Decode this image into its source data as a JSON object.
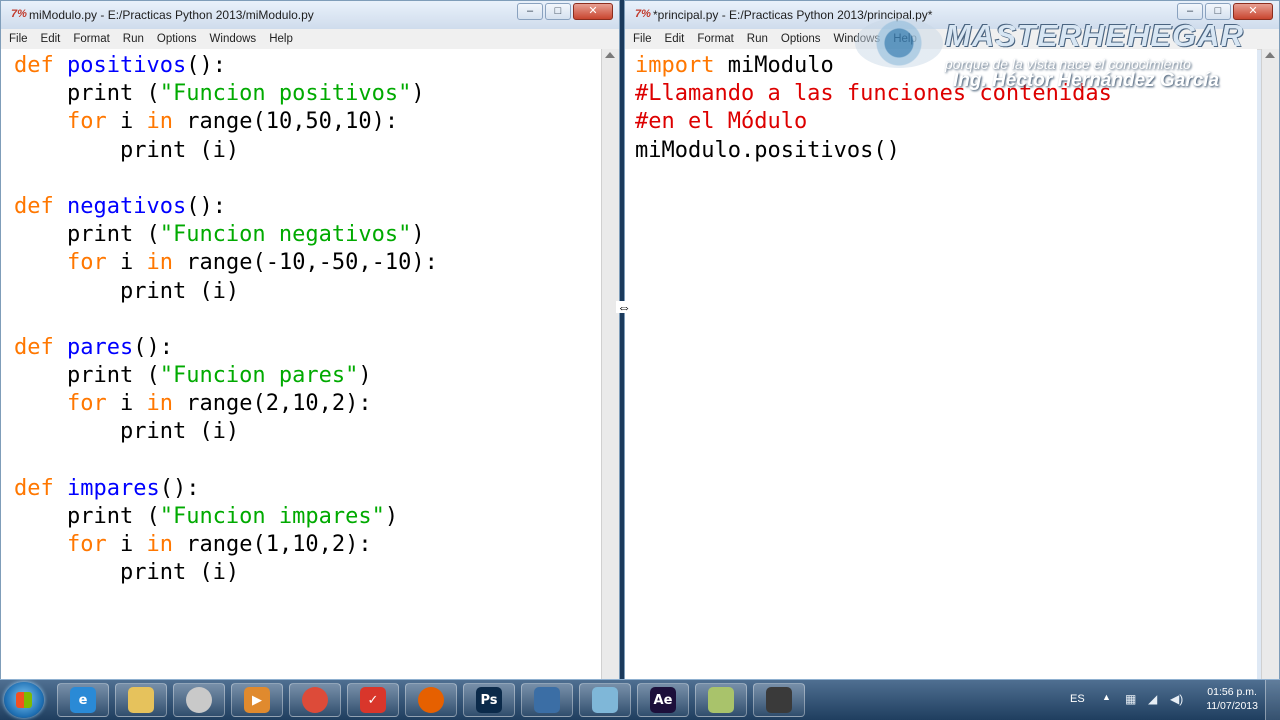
{
  "left_window": {
    "title": "miModulo.py - E:/Practicas Python 2013/miModulo.py",
    "icon_text": "7%",
    "menu": [
      "File",
      "Edit",
      "Format",
      "Run",
      "Options",
      "Windows",
      "Help"
    ],
    "code": [
      [
        {
          "t": "def",
          "c": "kw"
        },
        {
          "t": " "
        },
        {
          "t": "positivos",
          "c": "fn"
        },
        {
          "t": "():"
        }
      ],
      [
        {
          "t": "    print "
        },
        {
          "t": "(\"Funcion positivos\")",
          "c": "st_wrap"
        }
      ],
      [
        {
          "t": "    "
        },
        {
          "t": "for",
          "c": "kw"
        },
        {
          "t": " i "
        },
        {
          "t": "in",
          "c": "kw"
        },
        {
          "t": " range(10,50,10):"
        }
      ],
      [
        {
          "t": "        print (i)"
        }
      ],
      [
        {
          "t": ""
        }
      ],
      [
        {
          "t": "def",
          "c": "kw"
        },
        {
          "t": " "
        },
        {
          "t": "negativos",
          "c": "fn"
        },
        {
          "t": "():"
        }
      ],
      [
        {
          "t": "    print "
        },
        {
          "t": "(\"Funcion negativos\")",
          "c": "st_wrap"
        }
      ],
      [
        {
          "t": "    "
        },
        {
          "t": "for",
          "c": "kw"
        },
        {
          "t": " i "
        },
        {
          "t": "in",
          "c": "kw"
        },
        {
          "t": " range(-10,-50,-10):"
        }
      ],
      [
        {
          "t": "        print (i)"
        }
      ],
      [
        {
          "t": ""
        }
      ],
      [
        {
          "t": "def",
          "c": "kw"
        },
        {
          "t": " "
        },
        {
          "t": "pares",
          "c": "fn"
        },
        {
          "t": "():"
        }
      ],
      [
        {
          "t": "    print "
        },
        {
          "t": "(\"Funcion pares\")",
          "c": "st_wrap"
        }
      ],
      [
        {
          "t": "    "
        },
        {
          "t": "for",
          "c": "kw"
        },
        {
          "t": " i "
        },
        {
          "t": "in",
          "c": "kw"
        },
        {
          "t": " range(2,10,2):"
        }
      ],
      [
        {
          "t": "        print (i)"
        }
      ],
      [
        {
          "t": ""
        }
      ],
      [
        {
          "t": "def",
          "c": "kw"
        },
        {
          "t": " "
        },
        {
          "t": "impares",
          "c": "fn"
        },
        {
          "t": "():"
        }
      ],
      [
        {
          "t": "    print "
        },
        {
          "t": "(\"Funcion impares\")",
          "c": "st_wrap"
        }
      ],
      [
        {
          "t": "    "
        },
        {
          "t": "for",
          "c": "kw"
        },
        {
          "t": " i "
        },
        {
          "t": "in",
          "c": "kw"
        },
        {
          "t": " range(1,10,2):"
        }
      ],
      [
        {
          "t": "        print (i)"
        }
      ]
    ]
  },
  "right_window": {
    "title": "*principal.py - E:/Practicas Python 2013/principal.py*",
    "icon_text": "7%",
    "menu": [
      "File",
      "Edit",
      "Format",
      "Run",
      "Options",
      "Windows",
      "Help"
    ],
    "code": [
      [
        {
          "t": "import",
          "c": "kw"
        },
        {
          "t": " miModulo"
        }
      ],
      [
        {
          "t": "#Llamando a las funciones contenidas",
          "c": "cm"
        }
      ],
      [
        {
          "t": "#en el Módulo",
          "c": "cm"
        }
      ],
      [
        {
          "t": "miModulo.positivos()"
        }
      ]
    ]
  },
  "watermark": {
    "brand": "MASTERHEHEGAR",
    "tagline": "porque de la vista nace el conocimiento",
    "author": "Ing. Héctor Hernández García"
  },
  "taskbar": {
    "apps": [
      {
        "name": "internet-explorer",
        "label": "e",
        "color": "#2a8ad6"
      },
      {
        "name": "file-explorer",
        "label": "",
        "color": "#e6c25c"
      },
      {
        "name": "clock-app",
        "label": "",
        "color": "#c9c9c9"
      },
      {
        "name": "media-player",
        "label": "▶",
        "color": "#e08a2e"
      },
      {
        "name": "chrome",
        "label": "",
        "color": "#dd4b39"
      },
      {
        "name": "todoist",
        "label": "✓",
        "color": "#d9362b"
      },
      {
        "name": "firefox",
        "label": "",
        "color": "#e66000"
      },
      {
        "name": "photoshop",
        "label": "Ps",
        "color": "#0b2a4a"
      },
      {
        "name": "python",
        "label": "",
        "color": "#3b6ea5"
      },
      {
        "name": "notebook",
        "label": "",
        "color": "#7fb7d8"
      },
      {
        "name": "after-effects",
        "label": "Ae",
        "color": "#1c0f3a"
      },
      {
        "name": "notes",
        "label": "",
        "color": "#a9c36b"
      },
      {
        "name": "camcorder",
        "label": "",
        "color": "#3a3a3a"
      }
    ],
    "tray": {
      "language": "ES",
      "time": "01:56 p.m.",
      "date": "11/07/2013"
    }
  },
  "colors": {
    "keyword": "#ff7700",
    "function": "#0000ff",
    "string": "#00aa00",
    "comment": "#dd0000"
  }
}
